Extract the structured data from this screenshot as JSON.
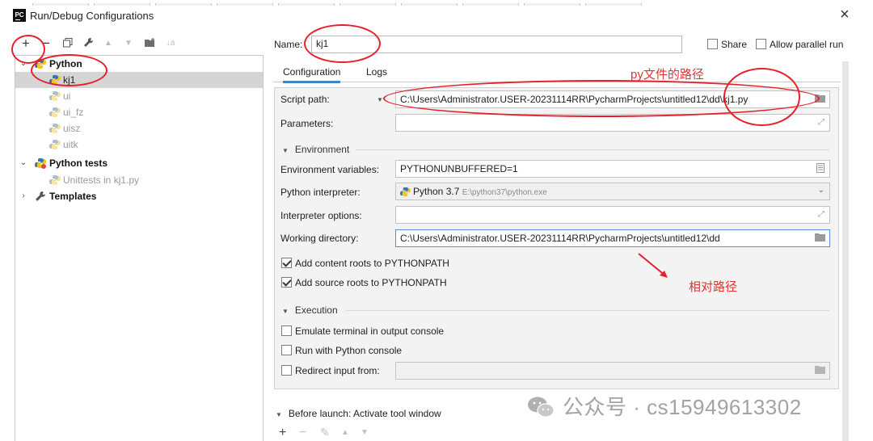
{
  "window": {
    "title": "Run/Debug Configurations",
    "app_icon": "PC",
    "close_glyph": "×"
  },
  "left_toolbar": {
    "icons": [
      "add-icon",
      "remove-icon",
      "copy-icon",
      "wrench-icon",
      "move-up-icon",
      "move-down-icon",
      "folder-icon",
      "sort-icon"
    ]
  },
  "tree": {
    "python_group": "Python",
    "python_items": [
      "kj1",
      "ui",
      "ui_fz",
      "uisz",
      "uitk"
    ],
    "selected": "kj1",
    "python_tests_group": "Python tests",
    "python_tests_items": [
      "Unittests in kj1.py"
    ],
    "templates_group": "Templates"
  },
  "header": {
    "name_label": "Name:",
    "name_value": "kj1",
    "share_label": "Share",
    "share_checked": false,
    "parallel_label": "Allow parallel run",
    "parallel_checked": false
  },
  "tabs": [
    {
      "label": "Configuration",
      "active": true
    },
    {
      "label": "Logs",
      "active": false
    }
  ],
  "config": {
    "script_path_label": "Script path:",
    "script_path_value": "C:\\Users\\Administrator.USER-20231114RR\\PycharmProjects\\untitled12\\dd\\kj1.py",
    "parameters_label": "Parameters:",
    "parameters_value": "",
    "environment_section": "Environment",
    "env_vars_label": "Environment variables:",
    "env_vars_value": "PYTHONUNBUFFERED=1",
    "interpreter_label": "Python interpreter:",
    "interpreter_name": "Python 3.7",
    "interpreter_path": "E:\\python37\\python.exe",
    "interp_options_label": "Interpreter options:",
    "interp_options_value": "",
    "working_dir_label": "Working directory:",
    "working_dir_value": "C:\\Users\\Administrator.USER-20231114RR\\PycharmProjects\\untitled12\\dd",
    "content_roots_label": "Add content roots to PYTHONPATH",
    "content_roots_checked": true,
    "source_roots_label": "Add source roots to PYTHONPATH",
    "source_roots_checked": true,
    "execution_section": "Execution",
    "emulate_terminal_label": "Emulate terminal in output console",
    "emulate_terminal_checked": false,
    "python_console_label": "Run with Python console",
    "python_console_checked": false,
    "redirect_input_label": "Redirect input from:",
    "redirect_input_checked": false,
    "redirect_input_value": ""
  },
  "before_launch": {
    "label": "Before launch: Activate tool window",
    "icons": [
      "add-icon",
      "remove-icon",
      "edit-icon",
      "move-up-icon",
      "move-down-icon"
    ]
  },
  "annotations": {
    "py_file_path": "py文件的路径",
    "relative_path": "相对路径",
    "color": "#e5202a"
  },
  "watermark": "公众号 · cs15949613302"
}
